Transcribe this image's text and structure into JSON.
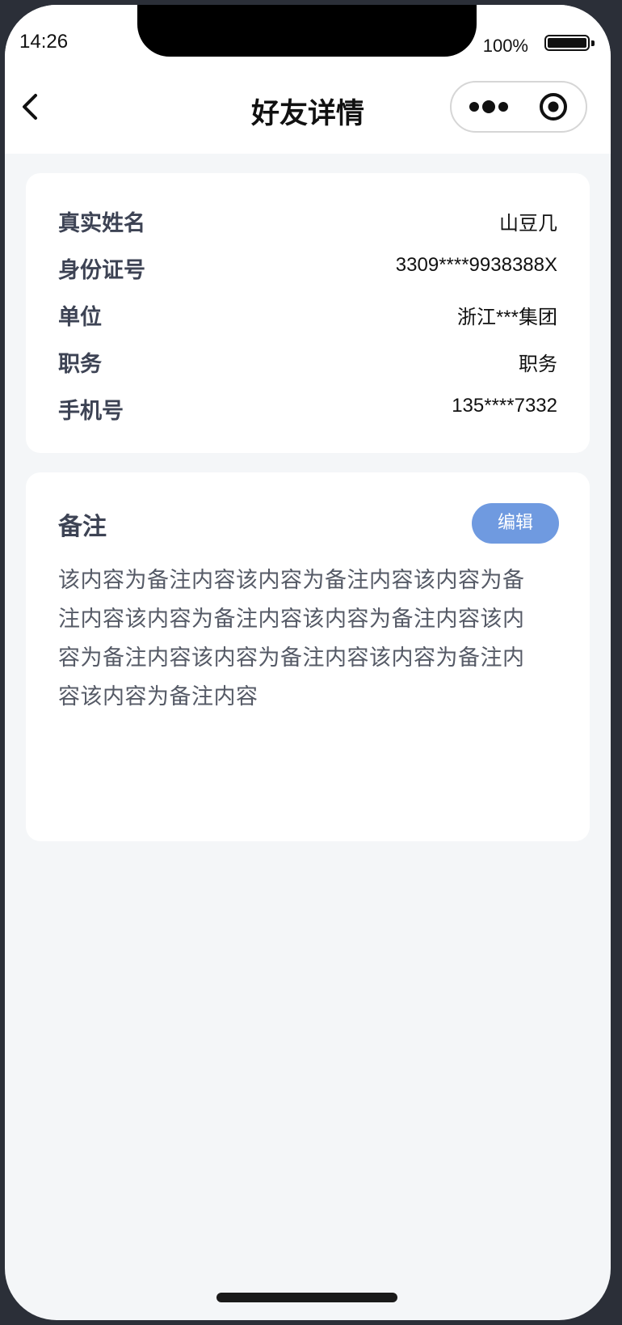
{
  "status_bar": {
    "time": "14:26",
    "battery_percent": "100%"
  },
  "nav": {
    "title": "好友详情",
    "back_icon": "chevron-left-icon",
    "more_icon": "more-dots-icon",
    "close_icon": "target-circle-icon"
  },
  "info": {
    "rows": [
      {
        "label": "真实姓名",
        "value": "山豆几"
      },
      {
        "label": "身份证号",
        "value": "3309****9938388X"
      },
      {
        "label": "单位",
        "value": "浙江***集团"
      },
      {
        "label": "职务",
        "value": "职务"
      },
      {
        "label": "手机号",
        "value": "135****7332"
      }
    ]
  },
  "remark": {
    "title": "备注",
    "edit_label": "编辑",
    "content": "该内容为备注内容该内容为备注内容该内容为备注内容该内容为备注内容该内容为备注内容该内容为备注内容该内容为备注内容该内容为备注内容该内容为备注内容"
  },
  "colors": {
    "accent": "#6f9ae0",
    "label": "#3d4354",
    "background": "#f4f6f8"
  }
}
